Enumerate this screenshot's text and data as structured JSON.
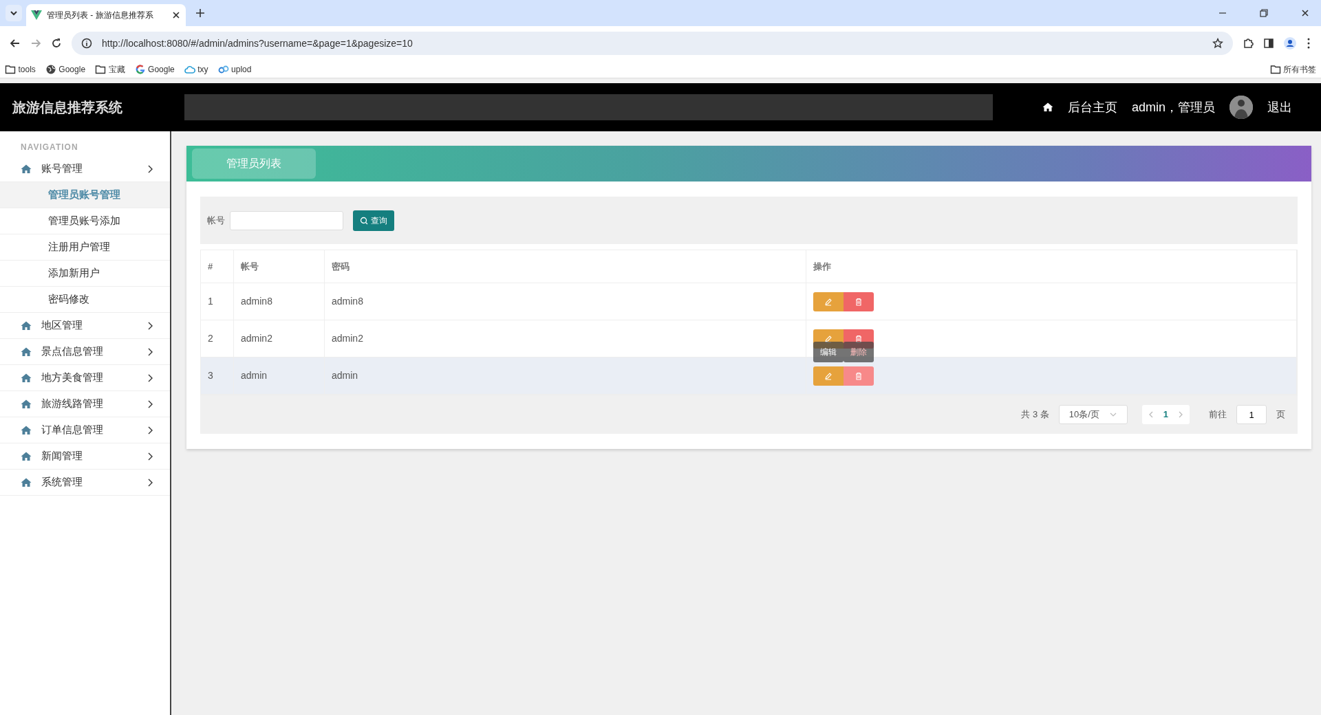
{
  "browser": {
    "tab_title": "管理员列表 - 旅游信息推荐系",
    "url": "http://localhost:8080/#/admin/admins?username=&page=1&pagesize=10",
    "bookmarks": [
      {
        "label": "tools",
        "kind": "folder"
      },
      {
        "label": "Google",
        "kind": "globe"
      },
      {
        "label": "宝藏",
        "kind": "folder"
      },
      {
        "label": "Google",
        "kind": "google"
      },
      {
        "label": "txy",
        "kind": "cloud"
      },
      {
        "label": "uplod",
        "kind": "link"
      }
    ],
    "all_bookmarks": "所有书签"
  },
  "header": {
    "title": "旅游信息推荐系统",
    "home": "后台主页",
    "user": "admin，管理员",
    "logout": "退出"
  },
  "sidebar": {
    "heading": "NAVIGATION",
    "items": [
      {
        "label": "账号管理",
        "children": [
          {
            "label": "管理员账号管理",
            "selected": true
          },
          {
            "label": "管理员账号添加",
            "selected": false
          },
          {
            "label": "注册用户管理",
            "selected": false
          },
          {
            "label": "添加新用户",
            "selected": false
          },
          {
            "label": "密码修改",
            "selected": false
          }
        ]
      },
      {
        "label": "地区管理"
      },
      {
        "label": "景点信息管理"
      },
      {
        "label": "地方美食管理"
      },
      {
        "label": "旅游线路管理"
      },
      {
        "label": "订单信息管理"
      },
      {
        "label": "新闻管理"
      },
      {
        "label": "系统管理"
      }
    ]
  },
  "page_title": "管理员列表",
  "search": {
    "label": "帐号",
    "button": "查询"
  },
  "table": {
    "columns": [
      "#",
      "帐号",
      "密码",
      "操作"
    ],
    "rows": [
      {
        "cells": [
          "1",
          "admin8",
          "admin8"
        ],
        "hovered": false,
        "actions": [
          {
            "kind": "edit",
            "hovered": false
          },
          {
            "kind": "delete",
            "hovered": false
          }
        ]
      },
      {
        "cells": [
          "2",
          "admin2",
          "admin2"
        ],
        "hovered": false,
        "actions": [
          {
            "kind": "edit",
            "hovered": false
          },
          {
            "kind": "delete",
            "hovered": false
          }
        ]
      },
      {
        "cells": [
          "3",
          "admin",
          "admin"
        ],
        "hovered": true,
        "actions": [
          {
            "kind": "edit",
            "hovered": false,
            "tooltip": "编辑"
          },
          {
            "kind": "delete",
            "hovered": true,
            "tooltip": "删除"
          }
        ]
      }
    ]
  },
  "pagination": {
    "total": "共 3 条",
    "page_size": "10条/页",
    "pages": [
      {
        "label": "1",
        "selected": true
      }
    ],
    "goto": "前往",
    "goto_value": "1",
    "page_unit": "页"
  }
}
